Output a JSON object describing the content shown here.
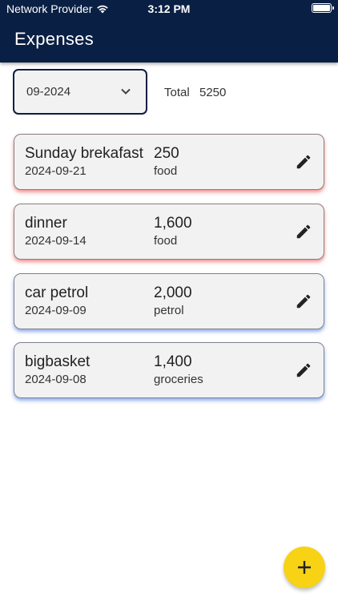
{
  "status_bar": {
    "carrier": "Network Provider",
    "time": "3:12 PM"
  },
  "header": {
    "title": "Expenses"
  },
  "filter": {
    "month": "09-2024",
    "total_label": "Total",
    "total_value": "5250"
  },
  "expenses": [
    {
      "name": "Sunday brekafast",
      "date": "2024-09-21",
      "amount": "250",
      "category": "food",
      "accent": "#e63c3c"
    },
    {
      "name": "dinner",
      "date": "2024-09-14",
      "amount": "1,600",
      "category": "food",
      "accent": "#e63c3c"
    },
    {
      "name": "car petrol",
      "date": "2024-09-09",
      "amount": "2,000",
      "category": "petrol",
      "accent": "#3c6edc"
    },
    {
      "name": "bigbasket",
      "date": "2024-09-08",
      "amount": "1,400",
      "category": "groceries",
      "accent": "#3c6edc"
    }
  ],
  "colors": {
    "app_bar": "#0a1f44",
    "fab": "#f7d215"
  },
  "icons": {
    "edit": "pencil-icon",
    "add": "plus-icon",
    "dropdown": "chevron-down-icon"
  }
}
